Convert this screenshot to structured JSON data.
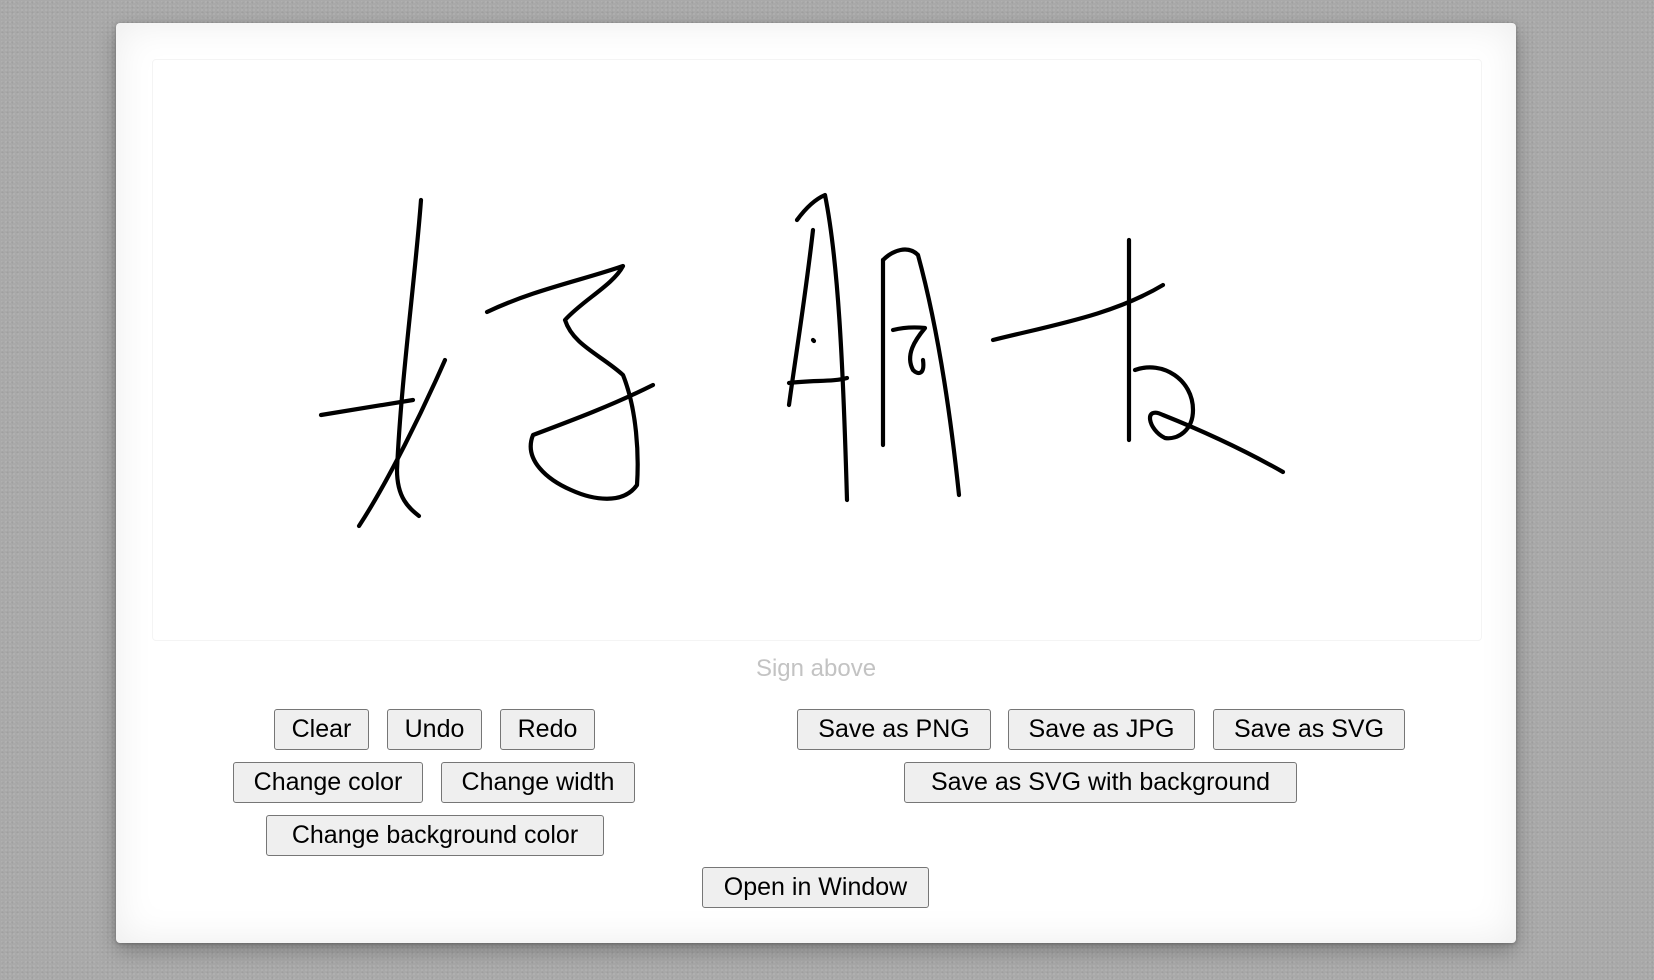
{
  "signature_pad": {
    "description": "Sign above"
  },
  "buttons": {
    "clear": "Clear",
    "undo": "Undo",
    "redo": "Redo",
    "change_color": "Change color",
    "change_width": "Change width",
    "change_background_color": "Change background color",
    "save_png": "Save as PNG",
    "save_jpg": "Save as JPG",
    "save_svg": "Save as SVG",
    "save_svg_bg": "Save as SVG with background",
    "open_window": "Open in Window"
  },
  "colors": {
    "page_background": "#a9a9a9",
    "pad_background": "#ffffff",
    "ink": "#000000",
    "description_text": "#c3c3c3",
    "button_background": "#efefef",
    "button_border": "#767676"
  }
}
